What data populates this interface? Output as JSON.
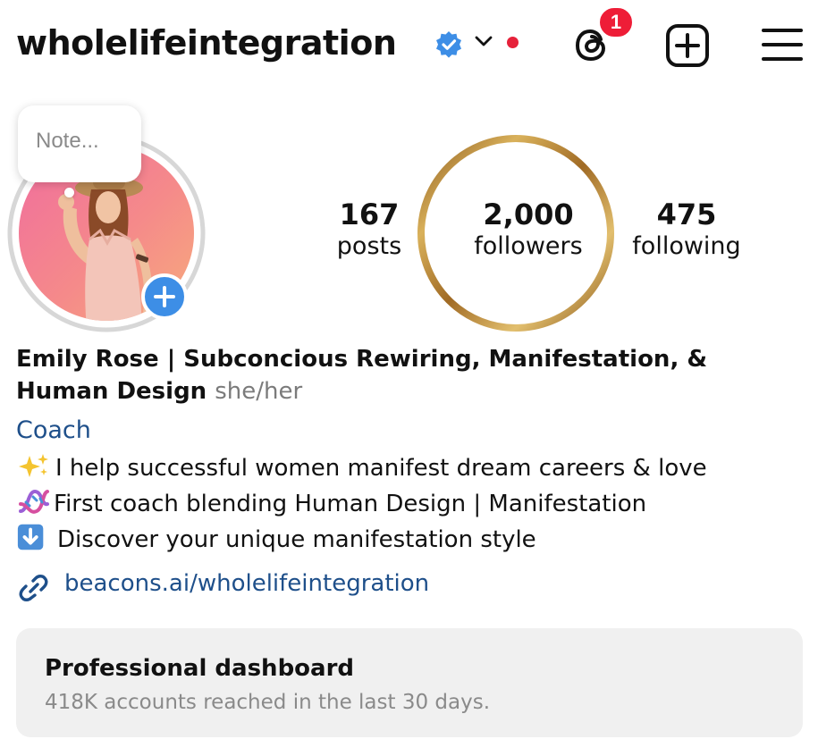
{
  "header": {
    "username": "wholelifeintegration",
    "verified_icon": "verified-badge-icon",
    "notification_count": "1",
    "accent_blue": "#3897f0",
    "alert_red": "#ee1d37"
  },
  "profile": {
    "note_placeholder": "Note...",
    "stats": [
      {
        "value": "167",
        "label": "posts"
      },
      {
        "value": "2,000",
        "label": "followers"
      },
      {
        "value": "475",
        "label": "following"
      }
    ],
    "ring_color": "#b8862b"
  },
  "bio": {
    "name": "Emily Rose | Subconcious Rewiring, Manifestation, &",
    "name_line2": "Human Design",
    "pronouns": "she/her",
    "category": "Coach",
    "lines": [
      "I help successful women manifest dream careers & love",
      "First coach blending Human Design | Manifestation",
      "Discover your unique manifestation style"
    ],
    "link": "beacons.ai/wholelifeintegration",
    "link_color": "#1e4f8a"
  },
  "dashboard": {
    "title": "Professional dashboard",
    "subtitle": "418K accounts reached in the last 30 days."
  }
}
